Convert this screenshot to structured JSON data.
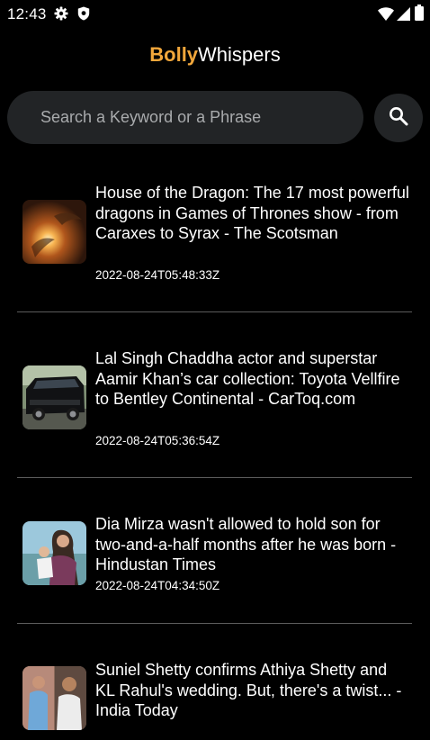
{
  "status_bar": {
    "time": "12:43",
    "left_icons": [
      "settings-icon",
      "shield-icon"
    ],
    "right_icons": [
      "wifi-icon",
      "signal-icon",
      "battery-icon"
    ]
  },
  "header": {
    "title_accent": "Bolly",
    "title_rest": "Whispers",
    "accent_color": "#f2a73b"
  },
  "search": {
    "placeholder": "Search a Keyword or a Phrase",
    "value": "",
    "button_icon": "search-icon"
  },
  "articles": [
    {
      "title": "House of the Dragon: The 17 most powerful dragons in Games of Thrones show - from Caraxes to Syrax - The Scotsman",
      "published": "2022-08-24T05:48:33Z",
      "thumbnail": "dragon-fire-image"
    },
    {
      "title": "Lal Singh Chaddha actor and superstar Aamir Khan’s car collection: Toyota Vellfire to Bentley Continental - CarToq.com",
      "published": "2022-08-24T05:36:54Z",
      "thumbnail": "car-image"
    },
    {
      "title": "Dia Mirza wasn't allowed to hold son for two-and-a-half months after he was born - Hindustan Times",
      "published": "2022-08-24T04:34:50Z",
      "thumbnail": "mother-child-image"
    },
    {
      "title": "Suniel Shetty confirms Athiya Shetty and KL Rahul's wedding. But, there's a twist... - India Today",
      "published": "",
      "thumbnail": "couple-image"
    }
  ]
}
